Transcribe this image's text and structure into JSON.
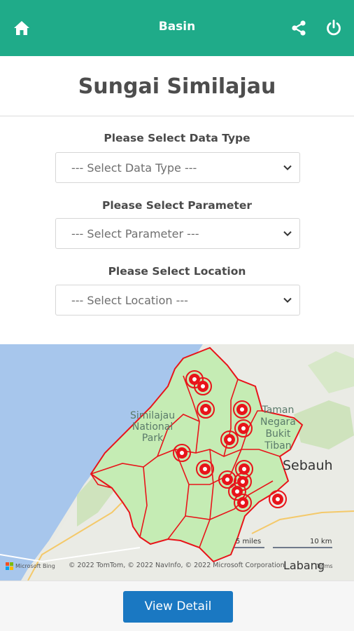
{
  "header": {
    "title": "Basin",
    "icons": [
      "home-icon",
      "share-icon",
      "power-icon"
    ],
    "bg_color": "#1fab89"
  },
  "page": {
    "title": "Sungai Similajau"
  },
  "form": {
    "data_type": {
      "label": "Please Select Data Type",
      "placeholder": "--- Select Data Type ---"
    },
    "parameter": {
      "label": "Please Select Parameter",
      "placeholder": "--- Select Parameter ---"
    },
    "location": {
      "label": "Please Select Location",
      "placeholder": "--- Select Location ---"
    }
  },
  "map": {
    "labels": {
      "park": [
        "Similajau",
        "National",
        "Park"
      ],
      "taman": [
        "Taman",
        "Negara",
        "Bukit",
        "Tiban"
      ],
      "town": "Sebauh",
      "bottom_town": "Labang"
    },
    "scale": {
      "miles": "5 miles",
      "km": "10 km"
    },
    "attribution": "© 2022 TomTom, © 2022 NavInfo, © 2022 Microsoft Corporation",
    "terms": "Terms",
    "provider": "Microsoft Bing",
    "marker_color": "#e8141a",
    "boundary_color": "#e8141a",
    "fill_color": "#c5ecb4"
  },
  "footer": {
    "button_label": "View Detail",
    "button_color": "#1a78c2"
  }
}
